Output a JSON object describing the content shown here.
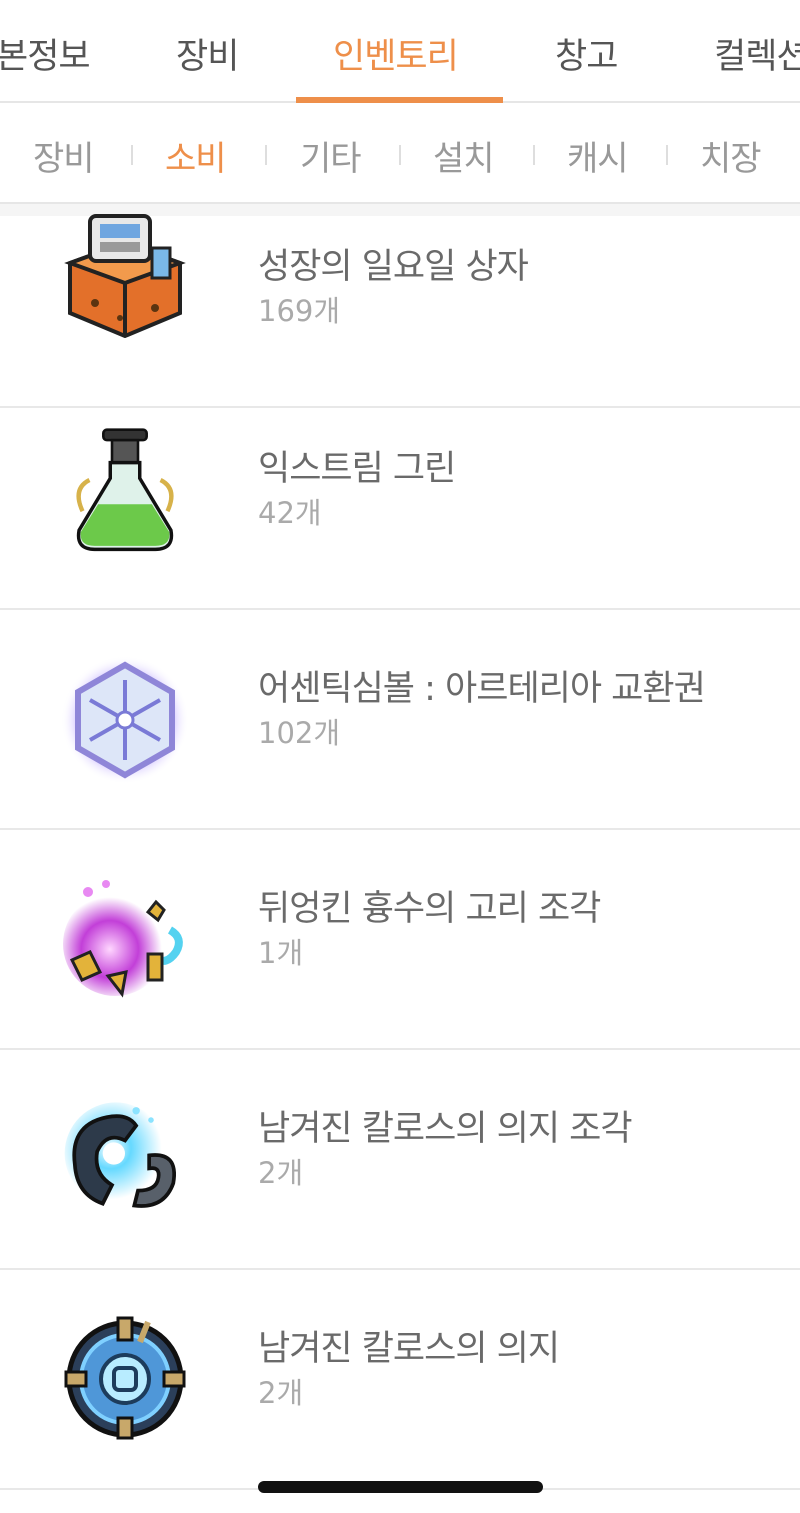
{
  "top_tabs": [
    {
      "label": "캐릭터정보",
      "visible": "본정보"
    },
    {
      "label": "장비"
    },
    {
      "label": "인벤토리"
    },
    {
      "label": "창고"
    },
    {
      "label": "컬렉션",
      "visible": "컬렉션"
    }
  ],
  "top_tabs_active": "인벤토리",
  "sub_tabs": [
    "장비",
    "소비",
    "기타",
    "설치",
    "캐시",
    "치장"
  ],
  "sub_tabs_active": "소비",
  "accent_color": "#ee8f4a",
  "items": [
    {
      "name": "성장의 일요일 상자",
      "count": "169개",
      "icon": "gift-box-icon"
    },
    {
      "name": "익스트림 그린",
      "count": "42개",
      "icon": "green-potion-icon"
    },
    {
      "name": "어센틱심볼 : 아르테리아 교환권",
      "count": "102개",
      "icon": "symbol-voucher-icon"
    },
    {
      "name": "뒤엉킨 흉수의 고리 조각",
      "count": "1개",
      "icon": "ring-fragment-icon"
    },
    {
      "name": "남겨진 칼로스의 의지 조각",
      "count": "2개",
      "icon": "kalos-will-fragment-icon"
    },
    {
      "name": "남겨진 칼로스의 의지",
      "count": "2개",
      "icon": "kalos-will-icon"
    }
  ]
}
